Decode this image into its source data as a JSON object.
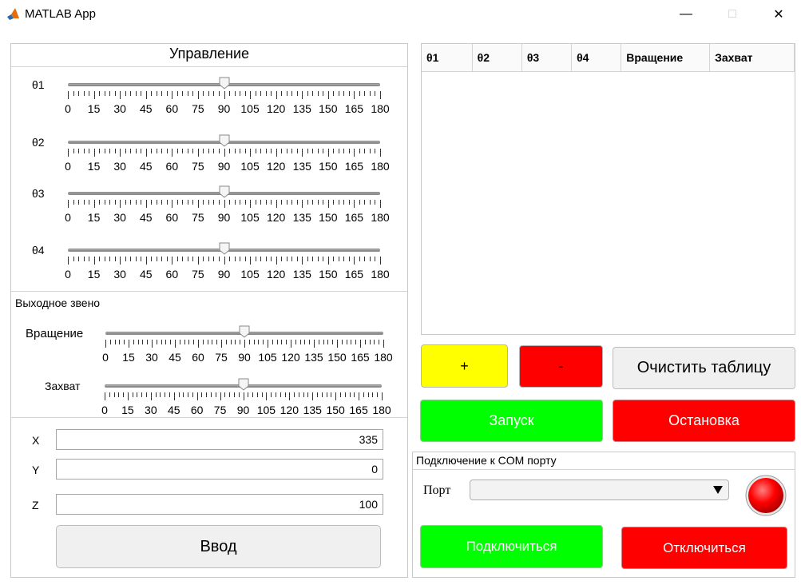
{
  "window": {
    "title": "MATLAB App",
    "minimize": "—",
    "maximize": "□",
    "close": "✕"
  },
  "control": {
    "title": "Управление",
    "joints": [
      {
        "label": "θ1",
        "value": 90
      },
      {
        "label": "θ2",
        "value": 90
      },
      {
        "label": "θ3",
        "value": 90
      },
      {
        "label": "θ4",
        "value": 90
      }
    ],
    "tick_labels": [
      "0",
      "15",
      "30",
      "45",
      "60",
      "75",
      "90",
      "105",
      "120",
      "135",
      "150",
      "165",
      "180"
    ]
  },
  "end_effector": {
    "title": "Выходное звено",
    "rotation": {
      "label": "Вращение",
      "value": 90
    },
    "grip": {
      "label": "Захват",
      "value": 90
    }
  },
  "coords": {
    "x": {
      "label": "X",
      "value": "335"
    },
    "y": {
      "label": "Y",
      "value": "0"
    },
    "z": {
      "label": "Z",
      "value": "100"
    },
    "enter_label": "Ввод"
  },
  "table": {
    "headers": [
      "θ1",
      "θ2",
      "θ3",
      "θ4",
      "Вращение",
      "Захват"
    ],
    "rows": []
  },
  "actions": {
    "add_label": "+",
    "remove_label": "-",
    "clear_label": "Очистить таблицу",
    "start_label": "Запуск",
    "stop_label": "Остановка"
  },
  "com": {
    "title": "Подключение к COM порту",
    "port_label": "Порт",
    "port_value": "",
    "connect_label": "Подключиться",
    "disconnect_label": "Отключиться",
    "status_color": "#ff0000"
  },
  "colors": {
    "yellow": "#ffff00",
    "red": "#ff0000",
    "green": "#00ff00"
  }
}
